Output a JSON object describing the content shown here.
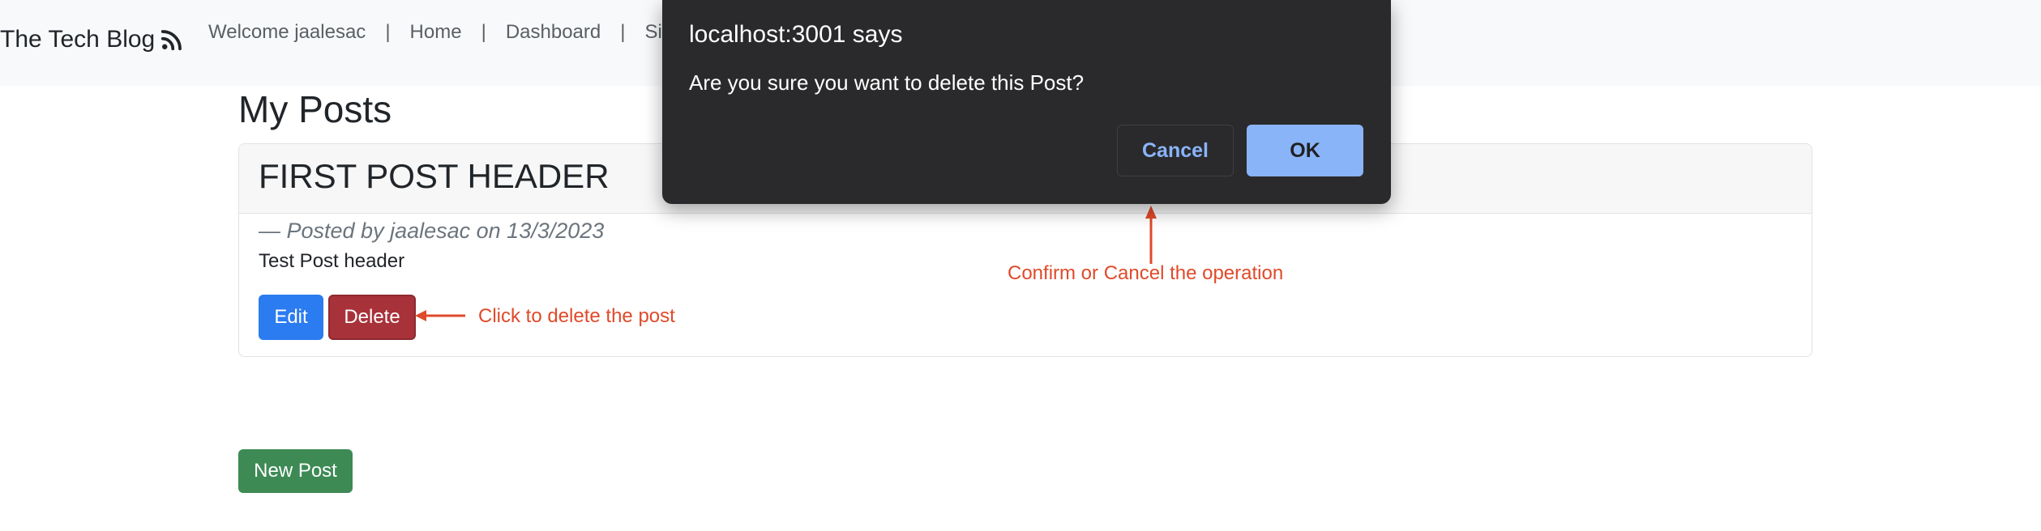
{
  "navbar": {
    "brand": "The Tech Blog",
    "brand_icon": "rss-icon",
    "links": {
      "welcome": "Welcome jaalesac",
      "home": "Home",
      "dashboard": "Dashboard",
      "partial": "Si"
    },
    "separator": "|"
  },
  "main": {
    "title": "My Posts",
    "post": {
      "header": "FIRST POST HEADER",
      "meta": "— Posted by jaalesac on 13/3/2023",
      "body": "Test Post header",
      "edit_label": "Edit",
      "delete_label": "Delete"
    },
    "new_post_label": "New Post"
  },
  "annotations": {
    "delete_hint": "Click to delete the post",
    "dialog_hint": "Confirm or Cancel the operation"
  },
  "dialog": {
    "origin": "localhost:3001 says",
    "message": "Are you sure you want to delete this Post?",
    "cancel_label": "Cancel",
    "ok_label": "OK"
  },
  "colors": {
    "annotation": "#e04a2a",
    "edit": "#2b7bf1",
    "delete": "#a8323a",
    "new_post": "#3d8a55",
    "dialog_bg": "#2a2a2c",
    "dialog_accent": "#8ab4f8"
  }
}
